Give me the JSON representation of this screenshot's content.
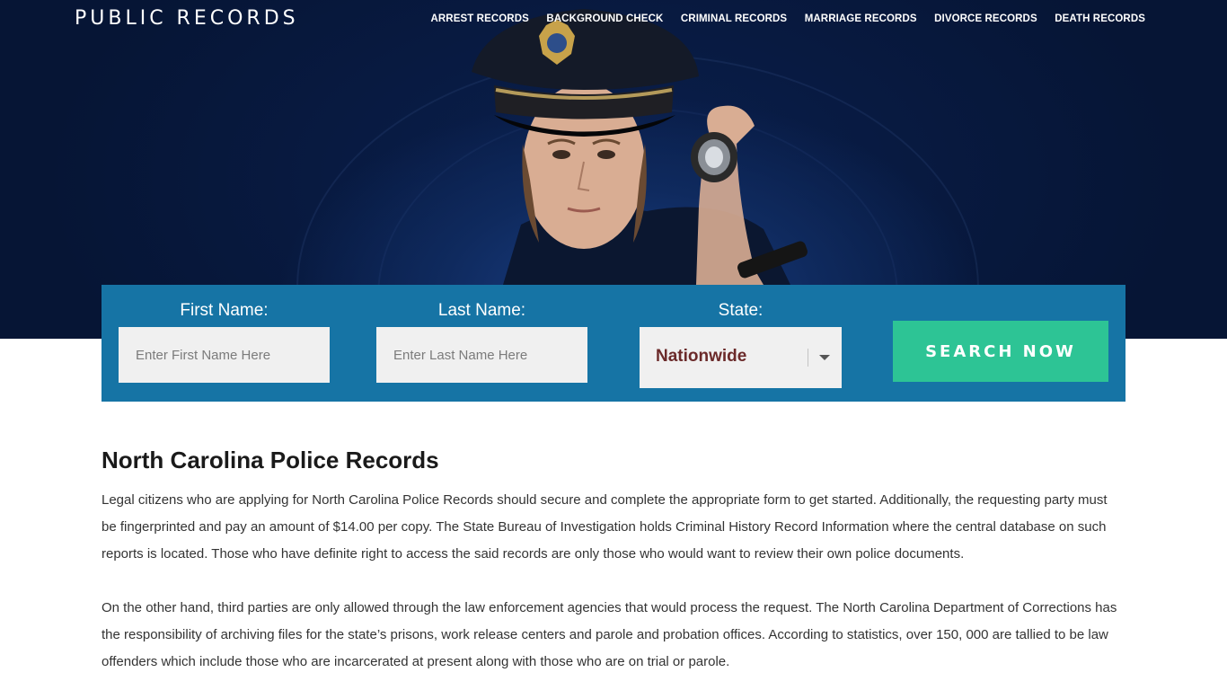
{
  "header": {
    "logo": "PUBLIC RECORDS",
    "nav": [
      {
        "label": "ARREST RECORDS"
      },
      {
        "label": "BACKGROUND CHECK"
      },
      {
        "label": "CRIMINAL RECORDS"
      },
      {
        "label": "MARRIAGE RECORDS"
      },
      {
        "label": "DIVORCE RECORDS"
      },
      {
        "label": "DEATH RECORDS"
      }
    ]
  },
  "search": {
    "first_name_label": "First Name:",
    "first_name_placeholder": "Enter First Name Here",
    "last_name_label": "Last Name:",
    "last_name_placeholder": "Enter Last Name Here",
    "state_label": "State:",
    "state_value": "Nationwide",
    "button_label": "SEARCH NOW"
  },
  "article": {
    "title": "North Carolina Police Records",
    "paragraphs": [
      "Legal citizens who are applying for North Carolina Police Records should secure and complete the appropriate form to get started. Additionally, the requesting party must be fingerprinted and pay an amount of $14.00 per copy. The State Bureau of Investigation holds Criminal History Record Information where the central database on such reports is located. Those who have definite right to access the said records are only those who would want to review their own police documents.",
      "On the other hand, third parties are only allowed through the law enforcement agencies that would process the request. The North Carolina Department of Corrections has the responsibility of archiving files for the state’s prisons, work release centers and parole and probation offices. According to statistics, over 150, 000 are tallied to be law offenders which include those who are incarcerated at present along with those who are on trial or parole."
    ]
  },
  "colors": {
    "hero_bg": "#061535",
    "search_panel": "#1674a5",
    "search_button": "#2dc495",
    "state_value": "#6b2a2a"
  }
}
